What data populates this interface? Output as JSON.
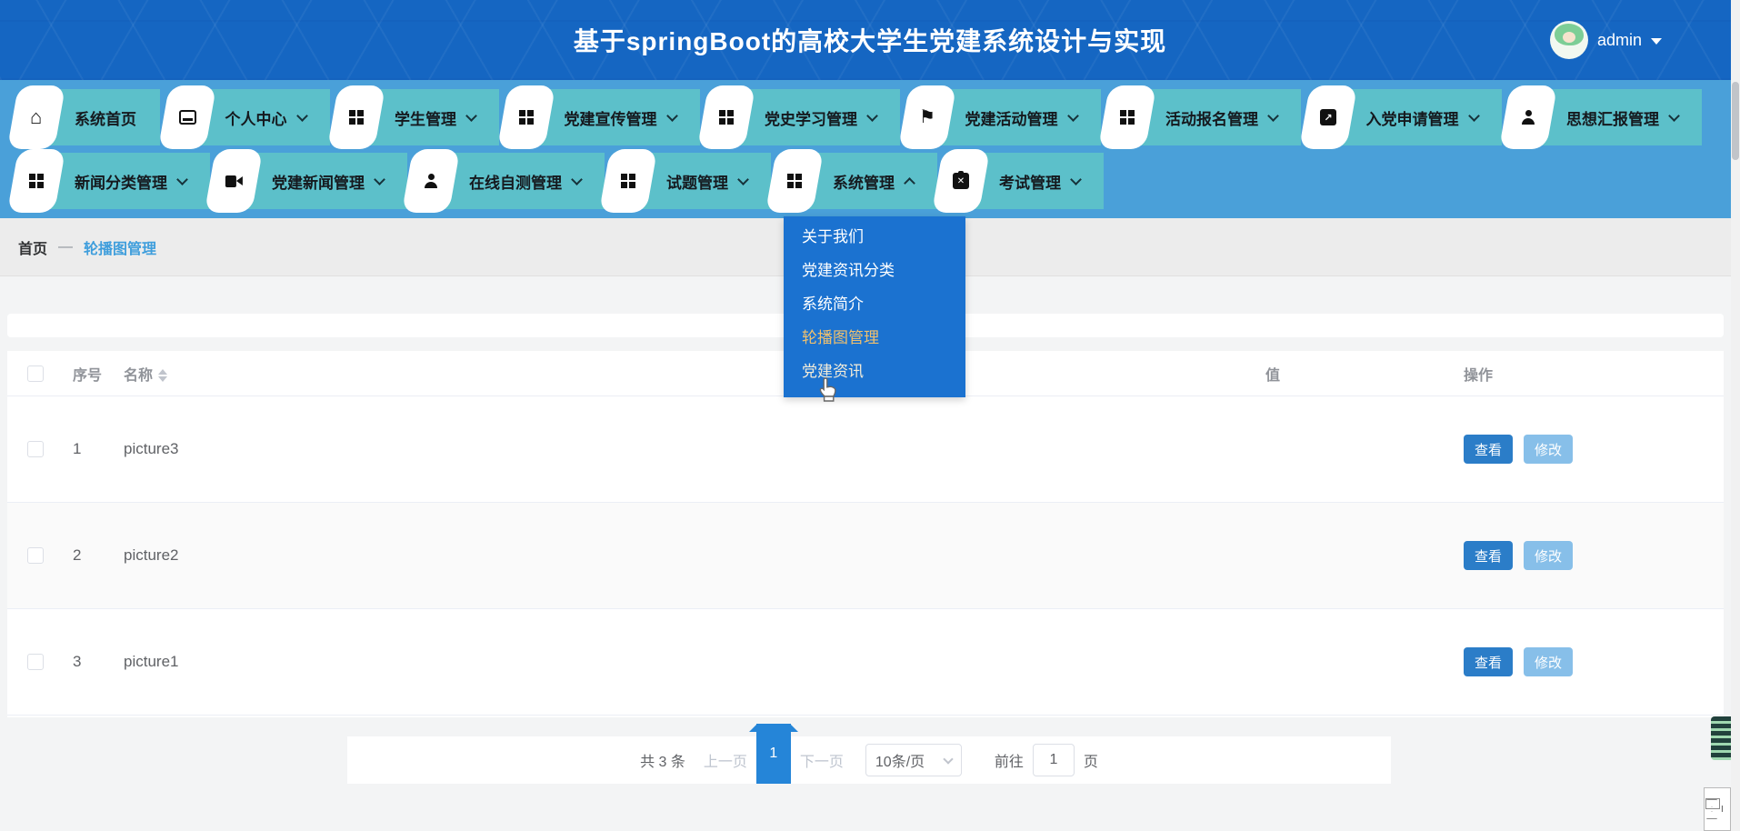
{
  "header": {
    "title": "基于springBoot的高校大学生党建系统设计与实现",
    "user": "admin"
  },
  "nav": {
    "row1": [
      {
        "label": "系统首页",
        "icon": "home-icon",
        "has_dropdown": false
      },
      {
        "label": "个人中心",
        "icon": "id-card-icon",
        "has_dropdown": true
      },
      {
        "label": "学生管理",
        "icon": "grid-icon",
        "has_dropdown": true
      },
      {
        "label": "党建宣传管理",
        "icon": "grid-icon",
        "has_dropdown": true
      },
      {
        "label": "党史学习管理",
        "icon": "grid-icon",
        "has_dropdown": true
      },
      {
        "label": "党建活动管理",
        "icon": "flag-icon",
        "has_dropdown": true
      },
      {
        "label": "活动报名管理",
        "icon": "grid-icon",
        "has_dropdown": true
      },
      {
        "label": "入党申请管理",
        "icon": "trend-chart-icon",
        "has_dropdown": true
      },
      {
        "label": "思想汇报管理",
        "icon": "person-icon",
        "has_dropdown": true
      }
    ],
    "row2": [
      {
        "label": "新闻分类管理",
        "icon": "grid-icon",
        "has_dropdown": true
      },
      {
        "label": "党建新闻管理",
        "icon": "video-icon",
        "has_dropdown": true
      },
      {
        "label": "在线自测管理",
        "icon": "person-icon",
        "has_dropdown": true
      },
      {
        "label": "试题管理",
        "icon": "grid-icon",
        "has_dropdown": true
      },
      {
        "label": "系统管理",
        "icon": "grid-icon",
        "has_dropdown": true,
        "expanded": true
      },
      {
        "label": "考试管理",
        "icon": "exam-clipboard-icon",
        "has_dropdown": true
      }
    ]
  },
  "dropdown": {
    "items": [
      {
        "label": "关于我们",
        "state": "normal"
      },
      {
        "label": "党建资讯分类",
        "state": "normal"
      },
      {
        "label": "系统简介",
        "state": "normal"
      },
      {
        "label": "轮播图管理",
        "state": "active"
      },
      {
        "label": "党建资讯",
        "state": "hovered"
      }
    ]
  },
  "breadcrumb": {
    "home": "首页",
    "separator": "—",
    "current": "轮播图管理"
  },
  "table": {
    "col_index": "序号",
    "col_name": "名称",
    "col_value": "值",
    "col_actions": "操作",
    "rows": [
      {
        "index": "1",
        "name": "picture3",
        "image": "coastal-city-bay-photo"
      },
      {
        "index": "2",
        "name": "picture2",
        "image": "sunset-cityscape-photo"
      },
      {
        "index": "3",
        "name": "picture1",
        "image": "dusk-cityscape-photo"
      }
    ],
    "view_label": "查看",
    "edit_label": "修改"
  },
  "pagination": {
    "total": "共 3 条",
    "prev": "上一页",
    "page": "1",
    "next": "下一页",
    "page_size": "10条/页",
    "goto_label": "前往",
    "goto_value": "1",
    "goto_unit": "页"
  },
  "colors": {
    "header_bg": "#1566c2",
    "nav_bg": "#4aa0d9",
    "nav_item_bg": "#5cc0ca",
    "dropdown_bg": "#1b72d0",
    "dropdown_active": "#efc06e",
    "link": "#3f9edc",
    "btn_view": "#2b7dc8",
    "btn_edit": "#87bfe9",
    "page_active": "#2585d8"
  }
}
